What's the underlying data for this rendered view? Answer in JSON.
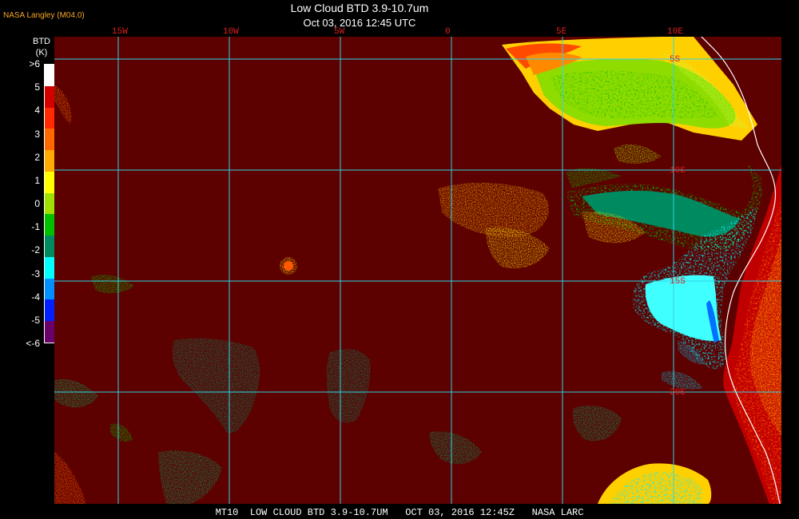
{
  "header": {
    "title": "Low Cloud BTD 3.9-10.7um",
    "datetime": "Oct 03, 2016 12:45 UTC",
    "source": "NASA Langley (M04.0)"
  },
  "legend": {
    "title_line1": "BTD",
    "title_line2": "(K)",
    "ticks": [
      ">6",
      "5",
      "4",
      "3",
      "2",
      "1",
      "0",
      "-1",
      "-2",
      "-3",
      "-4",
      "-5",
      "<-6"
    ],
    "colors": [
      "#ffffff",
      "#d40000",
      "#ff2a00",
      "#ff6a00",
      "#ffaa00",
      "#ffff00",
      "#a0e000",
      "#00c000",
      "#008a60",
      "#00ffff",
      "#0090ff",
      "#0020ff",
      "#6a006a"
    ]
  },
  "map": {
    "longitude_labels": [
      {
        "text": "15W",
        "lon": -15
      },
      {
        "text": "10W",
        "lon": -10
      },
      {
        "text": "5W",
        "lon": -5
      },
      {
        "text": "0",
        "lon": 0
      },
      {
        "text": "5E",
        "lon": 5
      },
      {
        "text": "10E",
        "lon": 10
      }
    ],
    "latitude_labels": [
      {
        "text": "5S",
        "lat": -5
      },
      {
        "text": "10S",
        "lat": -10
      },
      {
        "text": "15S",
        "lat": -15
      },
      {
        "text": "20S",
        "lat": -20
      }
    ],
    "colors": {
      "background": "#5c0000",
      "grid": "#2fd3e6",
      "coast": "#ffffff",
      "label": "#e0201c"
    }
  },
  "footer": {
    "text": "MT10  LOW CLOUD BTD 3.9-10.7UM   OCT 03, 2016 12:45Z   NASA LARC"
  }
}
